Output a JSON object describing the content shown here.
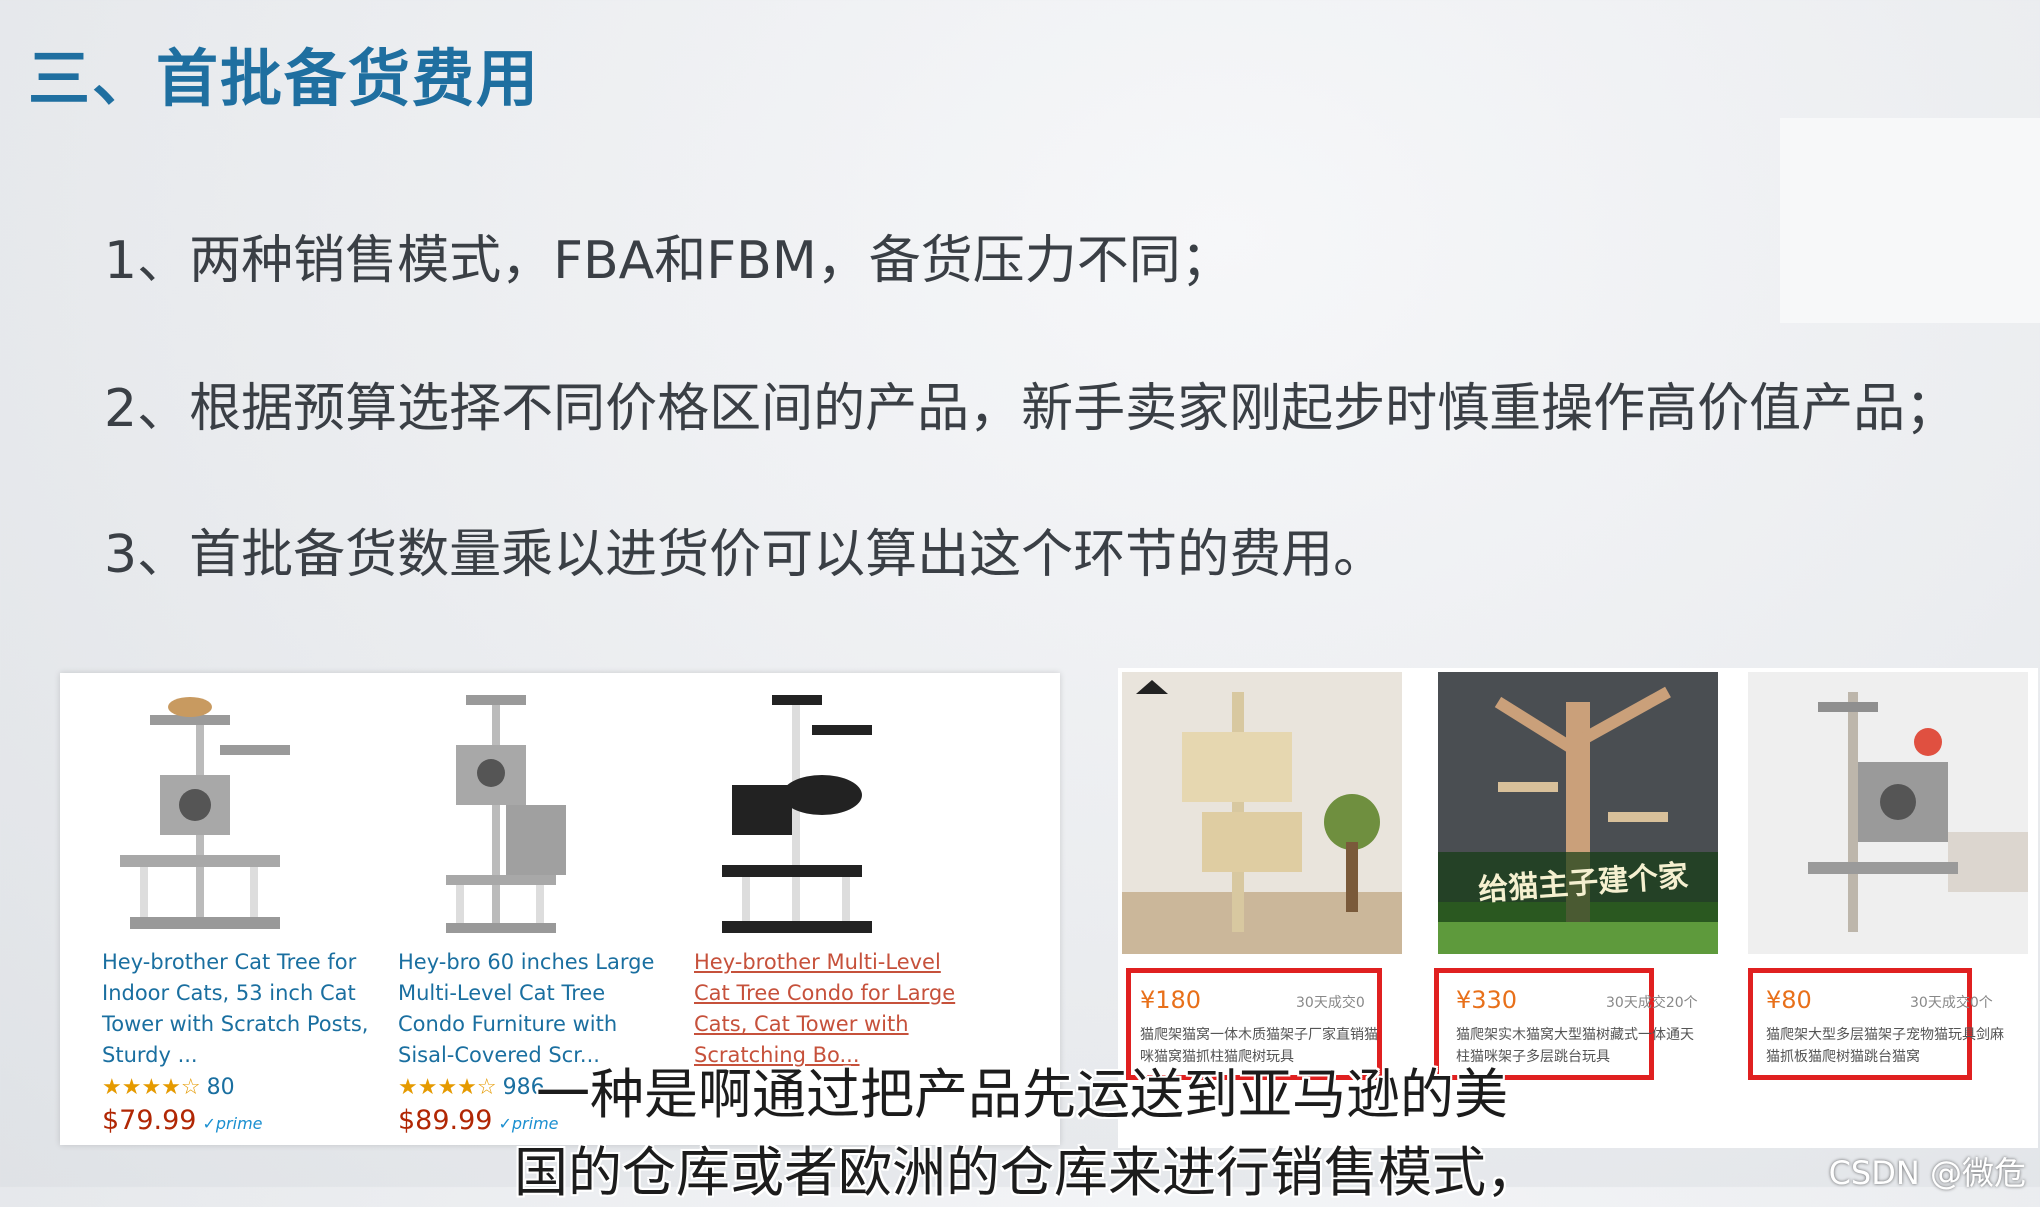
{
  "slide": {
    "title": "三、首批备货费用",
    "points": [
      "1、两种销售模式，FBA和FBM，备货压力不同；",
      "2、根据预算选择不同价格区间的产品，新手卖家刚起步时慎重操作高价值产品；",
      "3、首批备货数量乘以进货价可以算出这个环节的费用。"
    ]
  },
  "amazon_products": [
    {
      "title": "Hey-brother Cat Tree for Indoor Cats, 53 inch Cat Tower with Scratch Posts, Sturdy ...",
      "stars": "★★★★☆",
      "reviews": "80",
      "price": "$79.99",
      "prime": "✓prime",
      "icon": "cat-tree-icon"
    },
    {
      "title": "Hey-bro 60 inches Large Multi-Level Cat Tree Condo Furniture with Sisal-Covered Scr...",
      "stars": "★★★★☆",
      "reviews": "986",
      "price": "$89.99",
      "prime": "✓prime",
      "icon": "cat-tree-icon"
    },
    {
      "title": "Hey-brother Multi-Level Cat Tree Condo for Large Cats, Cat Tower with Scratching Bo...",
      "icon": "cat-tree-icon"
    }
  ],
  "cn_products": [
    {
      "price": "¥180",
      "sold": "30天成交0",
      "desc": "猫爬架猫窝一体木质猫架子厂家直销猫咪猫窝猫抓柱猫爬树玩具",
      "icon": "cat-tree-icon"
    },
    {
      "price": "¥330",
      "sold": "30天成交20个",
      "desc": "猫爬架实木猫窝大型猫树藏式一体通天柱猫咪架子多层跳台玩具",
      "icon": "cat-tree-icon",
      "banner": "给猫主子建个家"
    },
    {
      "price": "¥80",
      "sold": "30天成交0个",
      "desc": "猫爬架大型多层猫架子宠物猫玩具剑麻猫抓板猫爬树猫跳台猫窝",
      "icon": "cat-tree-icon"
    }
  ],
  "subtitles": {
    "line1": "一种是啊通过把产品先运送到亚马逊的美",
    "line2": "国的仓库或者欧洲的仓库来进行销售模式，"
  },
  "watermark": "CSDN @微危",
  "colors": {
    "title": "#1f6fa0",
    "amazon_link": "#1a6fa0",
    "amazon_price": "#b12704",
    "highlight_box": "#e02020",
    "cn_price": "#e8701a"
  }
}
